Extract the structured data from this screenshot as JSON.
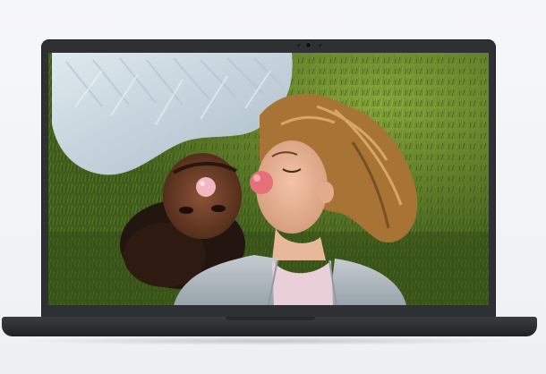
{
  "image": {
    "subject": "laptop-front-view",
    "colors": {
      "background": "#f2f4f7",
      "laptop_body": "#2e3033",
      "grass": "#4a6b22",
      "sweater": "#c9d6de",
      "bubble_gum": "#e98a95"
    }
  }
}
